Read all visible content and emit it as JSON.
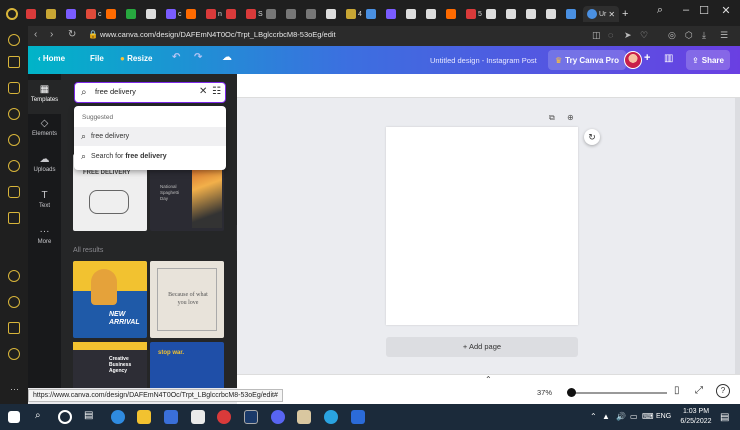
{
  "browser": {
    "tabs": [
      {
        "label": "",
        "color": "#d93a3a"
      },
      {
        "label": "",
        "color": "#c8a634"
      },
      {
        "label": "",
        "color": "#7a5cff"
      },
      {
        "label": "c",
        "color": "#e04a3a"
      },
      {
        "label": "",
        "color": "#ff6a00"
      },
      {
        "label": "",
        "color": "#27a83f"
      },
      {
        "label": "",
        "color": "#dddddd"
      },
      {
        "label": "c",
        "color": "#7a5cff"
      },
      {
        "label": "",
        "color": "#ff6a00"
      },
      {
        "label": "n",
        "color": "#d93a3a"
      },
      {
        "label": "",
        "color": "#d93a3a"
      },
      {
        "label": "S",
        "color": "#d93a3a"
      },
      {
        "label": "",
        "color": "#777777"
      },
      {
        "label": "",
        "color": "#777777"
      },
      {
        "label": "",
        "color": "#777777"
      },
      {
        "label": "",
        "color": "#dddddd"
      },
      {
        "label": "4",
        "color": "#c8a634"
      },
      {
        "label": "",
        "color": "#4a90e2"
      },
      {
        "label": "",
        "color": "#7a5cff"
      },
      {
        "label": "",
        "color": "#dddddd"
      },
      {
        "label": "",
        "color": "#dddddd"
      },
      {
        "label": "",
        "color": "#ff6a00"
      },
      {
        "label": "5",
        "color": "#d93a3a"
      },
      {
        "label": "",
        "color": "#dddddd"
      },
      {
        "label": "",
        "color": "#dddddd"
      },
      {
        "label": "",
        "color": "#dddddd"
      },
      {
        "label": "",
        "color": "#dddddd"
      },
      {
        "label": "",
        "color": "#4a90e2"
      }
    ],
    "active_tab": {
      "label": "Ur",
      "color": "#4a90e2"
    },
    "new_tab_label": "+",
    "url": "www.canva.com/design/DAFEmN4T0Oc/Trpt_LBglccrbcM8-53oEg/edit"
  },
  "canva_header": {
    "home_label": "Home",
    "file_label": "File",
    "resize_label": "Resize",
    "document_name": "Untitled design - Instagram Post",
    "try_pro_label": "Try Canva Pro",
    "share_label": "Share"
  },
  "rail": {
    "items": [
      {
        "label": "Templates",
        "icon": "templates-icon"
      },
      {
        "label": "Elements",
        "icon": "elements-icon"
      },
      {
        "label": "Uploads",
        "icon": "uploads-icon"
      },
      {
        "label": "Text",
        "icon": "text-icon"
      },
      {
        "label": "More",
        "icon": "more-icon"
      }
    ]
  },
  "search": {
    "query": "free delivery",
    "suggested_title": "Suggested",
    "suggestion_1": "free delivery",
    "search_for_prefix": "Search for",
    "search_for_term": "free delivery"
  },
  "panel": {
    "results_label": "All results",
    "thumb_texts": {
      "free_delivery": "FREE DELIVERY",
      "national_day": "National Spaghetti Day",
      "new_arrival": "NEW ARRIVAL",
      "because": "Because of what you love",
      "creative": "Creative Business Agency",
      "stop_war": "stop war."
    }
  },
  "workspace": {
    "add_page_label": "+ Add page",
    "zoom": "37%",
    "zoom_fraction": 0.0
  },
  "status_url": "https://www.canva.com/design/DAFEmN4T0Oc/Trpt_LBglccrbcM8-53oEg/edit#",
  "taskbar": {
    "lang": "ENG",
    "time": "1:03 PM",
    "date": "6/25/2022"
  }
}
